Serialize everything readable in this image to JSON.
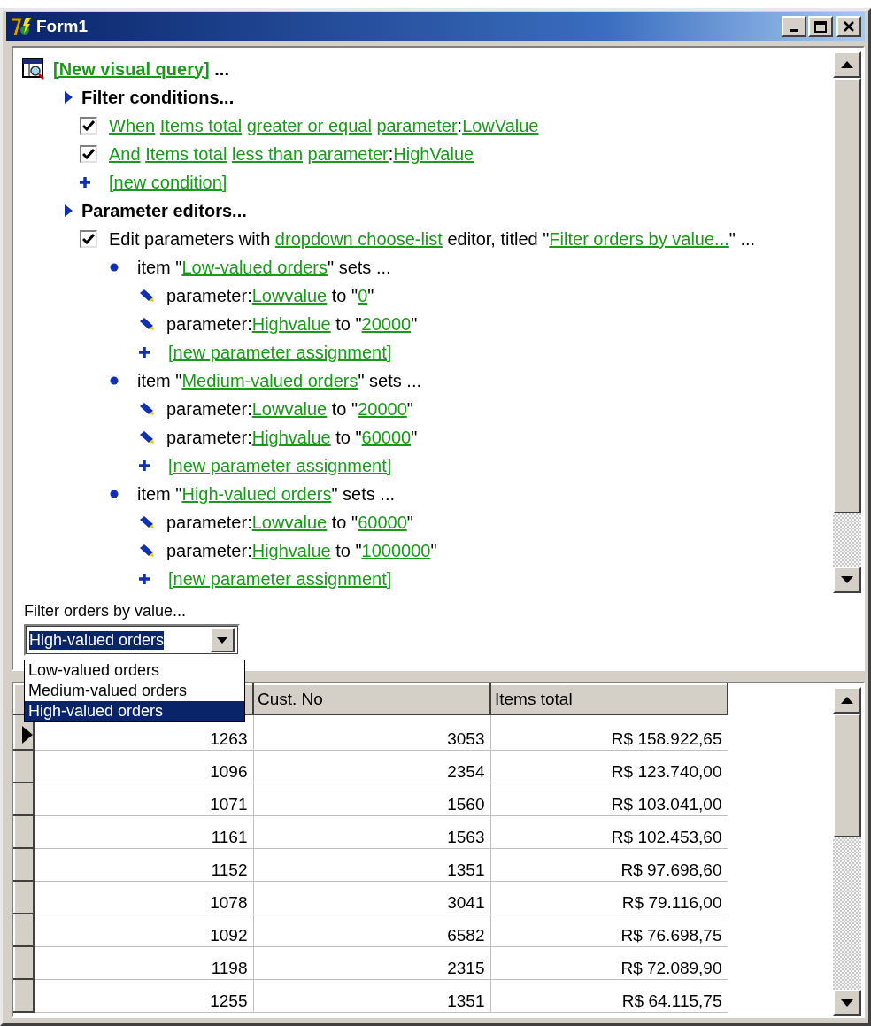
{
  "window": {
    "title": "Form1"
  },
  "query_tree": {
    "kind": "root",
    "parts": [
      {
        "text": "[New visual query]",
        "link": true
      },
      {
        "text": " ..."
      }
    ],
    "children": [
      {
        "kind": "section",
        "parts": [
          {
            "text": "Filter conditions..."
          }
        ],
        "children": [
          {
            "kind": "condition",
            "checked": true,
            "parts": [
              {
                "text": "When",
                "link": true,
                "space_after": true
              },
              {
                "text": "Items total",
                "link": true,
                "space_after": true
              },
              {
                "text": "greater or equal",
                "link": true,
                "space_after": true
              },
              {
                "text": "parameter",
                "link": true
              },
              {
                "text": ":"
              },
              {
                "text": "LowValue",
                "link": true
              }
            ]
          },
          {
            "kind": "condition",
            "checked": true,
            "parts": [
              {
                "text": "And",
                "link": true,
                "space_after": true
              },
              {
                "text": "Items total",
                "link": true,
                "space_after": true
              },
              {
                "text": "less than",
                "link": true,
                "space_after": true
              },
              {
                "text": "parameter",
                "link": true
              },
              {
                "text": ":"
              },
              {
                "text": "HighValue",
                "link": true
              }
            ]
          },
          {
            "kind": "add",
            "parts": [
              {
                "text": "[new condition]",
                "link": true
              }
            ]
          }
        ]
      },
      {
        "kind": "section",
        "parts": [
          {
            "text": "Parameter editors..."
          }
        ],
        "children": [
          {
            "kind": "editor",
            "checked": true,
            "parts": [
              {
                "text": "Edit parameters with "
              },
              {
                "text": "dropdown choose-list",
                "link": true
              },
              {
                "text": " editor, titled \""
              },
              {
                "text": "Filter orders by value...",
                "link": true
              },
              {
                "text": "\" ..."
              }
            ],
            "children": [
              {
                "kind": "item",
                "parts": [
                  {
                    "text": "item \""
                  },
                  {
                    "text": "Low-valued orders",
                    "link": true
                  },
                  {
                    "text": "\" sets ..."
                  }
                ],
                "children": [
                  {
                    "kind": "assignment",
                    "parts": [
                      {
                        "text": "parameter:"
                      },
                      {
                        "text": "Lowvalue",
                        "link": true
                      },
                      {
                        "text": " to \""
                      },
                      {
                        "text": "0",
                        "link": true
                      },
                      {
                        "text": "\""
                      }
                    ]
                  },
                  {
                    "kind": "assignment",
                    "parts": [
                      {
                        "text": "parameter:"
                      },
                      {
                        "text": "Highvalue",
                        "link": true
                      },
                      {
                        "text": " to \""
                      },
                      {
                        "text": "20000",
                        "link": true
                      },
                      {
                        "text": "\""
                      }
                    ]
                  },
                  {
                    "kind": "add",
                    "parts": [
                      {
                        "text": "[new parameter assignment]",
                        "link": true
                      }
                    ]
                  }
                ]
              },
              {
                "kind": "item",
                "parts": [
                  {
                    "text": "item \""
                  },
                  {
                    "text": "Medium-valued orders",
                    "link": true
                  },
                  {
                    "text": "\" sets ..."
                  }
                ],
                "children": [
                  {
                    "kind": "assignment",
                    "parts": [
                      {
                        "text": "parameter:"
                      },
                      {
                        "text": "Lowvalue",
                        "link": true
                      },
                      {
                        "text": " to \""
                      },
                      {
                        "text": "20000",
                        "link": true
                      },
                      {
                        "text": "\""
                      }
                    ]
                  },
                  {
                    "kind": "assignment",
                    "parts": [
                      {
                        "text": "parameter:"
                      },
                      {
                        "text": "Highvalue",
                        "link": true
                      },
                      {
                        "text": " to \""
                      },
                      {
                        "text": "60000",
                        "link": true
                      },
                      {
                        "text": "\""
                      }
                    ]
                  },
                  {
                    "kind": "add",
                    "parts": [
                      {
                        "text": "[new parameter assignment]",
                        "link": true
                      }
                    ]
                  }
                ]
              },
              {
                "kind": "item",
                "parts": [
                  {
                    "text": "item \""
                  },
                  {
                    "text": "High-valued orders",
                    "link": true
                  },
                  {
                    "text": "\" sets ..."
                  }
                ],
                "children": [
                  {
                    "kind": "assignment",
                    "parts": [
                      {
                        "text": "parameter:"
                      },
                      {
                        "text": "Lowvalue",
                        "link": true
                      },
                      {
                        "text": " to \""
                      },
                      {
                        "text": "60000",
                        "link": true
                      },
                      {
                        "text": "\""
                      }
                    ]
                  },
                  {
                    "kind": "assignment",
                    "parts": [
                      {
                        "text": "parameter:"
                      },
                      {
                        "text": "Highvalue",
                        "link": true
                      },
                      {
                        "text": " to \""
                      },
                      {
                        "text": "1000000",
                        "link": true
                      },
                      {
                        "text": "\""
                      }
                    ]
                  },
                  {
                    "kind": "add",
                    "parts": [
                      {
                        "text": "[new parameter assignment]",
                        "link": true
                      }
                    ]
                  }
                ]
              }
            ]
          }
        ]
      }
    ]
  },
  "filter": {
    "label": "Filter orders by value...",
    "value": "High-valued orders",
    "options": [
      {
        "label": "Low-valued orders",
        "selected": false
      },
      {
        "label": "Medium-valued orders",
        "selected": false
      },
      {
        "label": "High-valued orders",
        "selected": true
      }
    ]
  },
  "grid": {
    "columns": [
      null,
      "Cust. No",
      "Items total"
    ],
    "rows": [
      {
        "current": true,
        "cells": [
          "1263",
          "3053",
          "R$ 158.922,65"
        ]
      },
      {
        "current": false,
        "cells": [
          "1096",
          "2354",
          "R$ 123.740,00"
        ]
      },
      {
        "current": false,
        "cells": [
          "1071",
          "1560",
          "R$ 103.041,00"
        ]
      },
      {
        "current": false,
        "cells": [
          "1161",
          "1563",
          "R$ 102.453,60"
        ]
      },
      {
        "current": false,
        "cells": [
          "1152",
          "1351",
          "R$ 97.698,60"
        ]
      },
      {
        "current": false,
        "cells": [
          "1078",
          "3041",
          "R$ 79.116,00"
        ]
      },
      {
        "current": false,
        "cells": [
          "1092",
          "6582",
          "R$ 76.698,75"
        ]
      },
      {
        "current": false,
        "cells": [
          "1198",
          "2315",
          "R$ 72.089,90"
        ]
      },
      {
        "current": false,
        "cells": [
          "1255",
          "1351",
          "R$ 64.115,75"
        ]
      }
    ]
  }
}
